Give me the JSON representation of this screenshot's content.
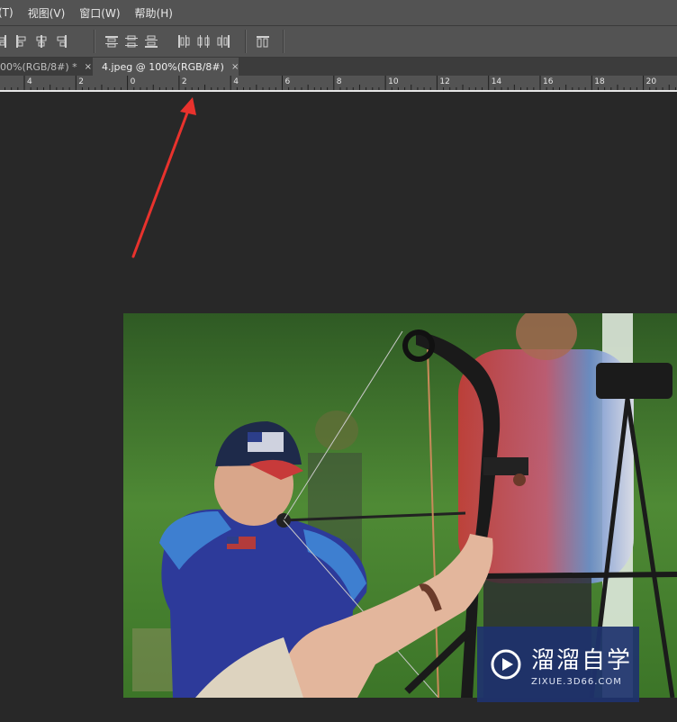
{
  "menu": {
    "items": [
      {
        "label": "(T)"
      },
      {
        "label": "视图(V)"
      },
      {
        "label": "窗口(W)"
      },
      {
        "label": "帮助(H)"
      }
    ]
  },
  "tabs": [
    {
      "label": "00%(RGB/8#) *",
      "close": "×",
      "active": false
    },
    {
      "label": "4.jpeg @ 100%(RGB/8#)",
      "close": "×",
      "active": true
    }
  ],
  "ruler": {
    "labels": [
      "4",
      "2",
      "0",
      "2",
      "4",
      "6",
      "8",
      "10",
      "12",
      "14",
      "16",
      "18",
      "20"
    ]
  },
  "watermark": {
    "title": "溜溜自学",
    "url": "ZIXUE.3D66.COM"
  },
  "colors": {
    "arrow": "#e8322d",
    "menubar": "#535353",
    "canvas": "#282828"
  }
}
